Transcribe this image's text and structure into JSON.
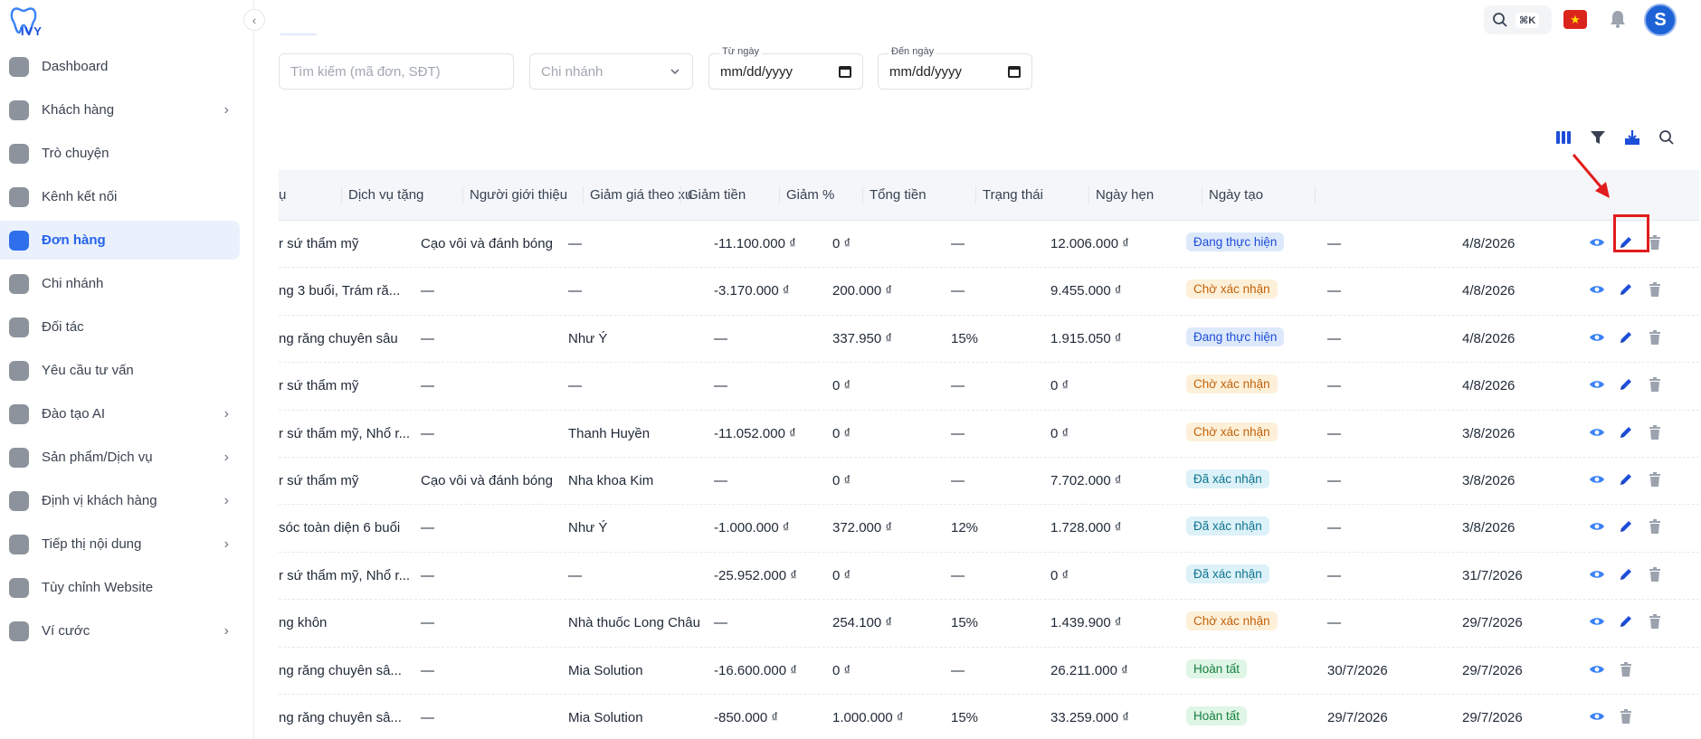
{
  "app": {
    "logo_text": "IVY"
  },
  "sidebar": {
    "items": [
      {
        "label": "Dashboard",
        "icon": "home-icon",
        "chevron": false,
        "active": false
      },
      {
        "label": "Khách hàng",
        "icon": "users-icon",
        "chevron": true,
        "active": false
      },
      {
        "label": "Trò chuyện",
        "icon": "chat-icon",
        "chevron": false,
        "active": false
      },
      {
        "label": "Kênh kết nối",
        "icon": "link-icon",
        "chevron": false,
        "active": false
      },
      {
        "label": "Đơn hàng",
        "icon": "shopping-bag-icon",
        "chevron": false,
        "active": true
      },
      {
        "label": "Chi nhánh",
        "icon": "building-icon",
        "chevron": false,
        "active": false
      },
      {
        "label": "Đối tác",
        "icon": "handshake-icon",
        "chevron": false,
        "active": false
      },
      {
        "label": "Yêu cầu tư vấn",
        "icon": "inbox-icon",
        "chevron": false,
        "active": false
      },
      {
        "label": "Đào tạo AI",
        "icon": "chip-icon",
        "chevron": true,
        "active": false
      },
      {
        "label": "Sản phẩm/Dịch vụ",
        "icon": "tooth-icon",
        "chevron": true,
        "active": false
      },
      {
        "label": "Định vị khách hàng",
        "icon": "target-icon",
        "chevron": true,
        "active": false
      },
      {
        "label": "Tiếp thị nội dung",
        "icon": "document-icon",
        "chevron": true,
        "active": false
      },
      {
        "label": "Tùy chỉnh Website",
        "icon": "website-icon",
        "chevron": false,
        "active": false
      },
      {
        "label": "Ví cước",
        "icon": "wallet-icon",
        "chevron": true,
        "active": false
      }
    ]
  },
  "topbar": {
    "kbd": "⌘K",
    "avatar_letter": "S"
  },
  "filters": {
    "search_placeholder": "Tìm kiếm (mã đơn, SĐT)",
    "branch_placeholder": "Chi nhánh",
    "from_label": "Từ ngày",
    "from_value": "mm/dd/yyyy",
    "to_label": "Đến ngày",
    "to_value": "mm/dd/yyyy"
  },
  "table": {
    "headers": [
      "ụ",
      "Dịch vụ tặng",
      "Người giới thiệu",
      "Giảm giá theo xu",
      "Giảm tiền",
      "Giảm %",
      "Tổng tiền",
      "Trạng thái",
      "Ngày hẹn",
      "Ngày tạo"
    ],
    "rows": [
      {
        "service": "r sứ thẩm mỹ",
        "gift": "Cạo vôi và đánh bóng",
        "ref": "—",
        "coin": "-11.100.000 ₫",
        "disc": "0 ₫",
        "pct": "—",
        "total": "12.006.000 ₫",
        "status": "Đang thực hiện",
        "status_type": "blue",
        "appt": "—",
        "created": "4/8/2026",
        "edit": true
      },
      {
        "service": "ng 3 buổi, Trám ră...",
        "gift": "—",
        "ref": "—",
        "coin": "-3.170.000 ₫",
        "disc": "200.000 ₫",
        "pct": "—",
        "total": "9.455.000 ₫",
        "status": "Chờ xác nhận",
        "status_type": "orange",
        "appt": "—",
        "created": "4/8/2026",
        "edit": true
      },
      {
        "service": "ng răng chuyên sâu",
        "gift": "—",
        "ref": "Như Ý",
        "coin": "—",
        "disc": "337.950 ₫",
        "pct": "15%",
        "total": "1.915.050 ₫",
        "status": "Đang thực hiện",
        "status_type": "blue",
        "appt": "—",
        "created": "4/8/2026",
        "edit": true
      },
      {
        "service": "r sứ thẩm mỹ",
        "gift": "—",
        "ref": "—",
        "coin": "—",
        "disc": "0 ₫",
        "pct": "—",
        "total": "0 ₫",
        "status": "Chờ xác nhận",
        "status_type": "orange",
        "appt": "—",
        "created": "4/8/2026",
        "edit": true
      },
      {
        "service": "r sứ thẩm mỹ, Nhổ r...",
        "gift": "—",
        "ref": "Thanh Huyền",
        "coin": "-11.052.000 ₫",
        "disc": "0 ₫",
        "pct": "—",
        "total": "0 ₫",
        "status": "Chờ xác nhận",
        "status_type": "orange",
        "appt": "—",
        "created": "3/8/2026",
        "edit": true
      },
      {
        "service": "r sứ thẩm mỹ",
        "gift": "Cạo vôi và đánh bóng",
        "ref": "Nha khoa Kim",
        "coin": "—",
        "disc": "0 ₫",
        "pct": "—",
        "total": "7.702.000 ₫",
        "status": "Đã xác nhận",
        "status_type": "cyan",
        "appt": "—",
        "created": "3/8/2026",
        "edit": true
      },
      {
        "service": "sóc toàn diện 6 buổi",
        "gift": "—",
        "ref": "Như Ý",
        "coin": "-1.000.000 ₫",
        "disc": "372.000 ₫",
        "pct": "12%",
        "total": "1.728.000 ₫",
        "status": "Đã xác nhận",
        "status_type": "cyan",
        "appt": "—",
        "created": "3/8/2026",
        "edit": true
      },
      {
        "service": "r sứ thẩm mỹ, Nhổ r...",
        "gift": "—",
        "ref": "—",
        "coin": "-25.952.000 ₫",
        "disc": "0 ₫",
        "pct": "—",
        "total": "0 ₫",
        "status": "Đã xác nhận",
        "status_type": "cyan",
        "appt": "—",
        "created": "31/7/2026",
        "edit": true
      },
      {
        "service": "ng khôn",
        "gift": "—",
        "ref": "Nhà thuốc Long Châu",
        "coin": "—",
        "disc": "254.100 ₫",
        "pct": "15%",
        "total": "1.439.900 ₫",
        "status": "Chờ xác nhận",
        "status_type": "orange",
        "appt": "—",
        "created": "29/7/2026",
        "edit": true
      },
      {
        "service": "ng răng chuyên sâ...",
        "gift": "—",
        "ref": "Mia Solution",
        "coin": "-16.600.000 ₫",
        "disc": "0 ₫",
        "pct": "—",
        "total": "26.211.000 ₫",
        "status": "Hoàn tất",
        "status_type": "green",
        "appt": "30/7/2026",
        "created": "29/7/2026",
        "edit": false
      },
      {
        "service": "ng răng chuyên sâ...",
        "gift": "—",
        "ref": "Mia Solution",
        "coin": "-850.000 ₫",
        "disc": "1.000.000 ₫",
        "pct": "15%",
        "total": "33.259.000 ₫",
        "status": "Hoàn tất",
        "status_type": "green",
        "appt": "29/7/2026",
        "created": "29/7/2026",
        "edit": false
      }
    ]
  },
  "colors": {
    "accent": "#2563eb",
    "highlight": "#e11d1d"
  }
}
